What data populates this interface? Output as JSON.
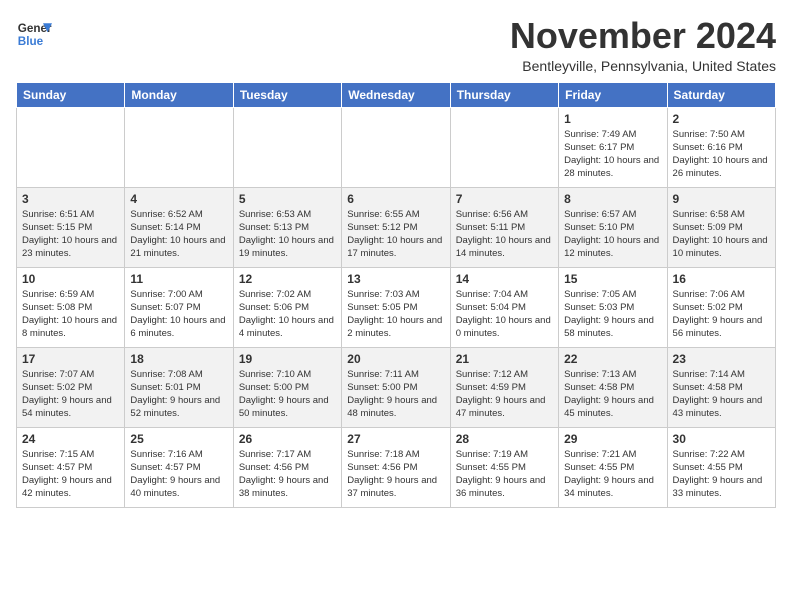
{
  "logo": {
    "line1": "General",
    "line2": "Blue"
  },
  "title": "November 2024",
  "location": "Bentleyville, Pennsylvania, United States",
  "weekdays": [
    "Sunday",
    "Monday",
    "Tuesday",
    "Wednesday",
    "Thursday",
    "Friday",
    "Saturday"
  ],
  "weeks": [
    [
      {
        "day": "",
        "info": ""
      },
      {
        "day": "",
        "info": ""
      },
      {
        "day": "",
        "info": ""
      },
      {
        "day": "",
        "info": ""
      },
      {
        "day": "",
        "info": ""
      },
      {
        "day": "1",
        "info": "Sunrise: 7:49 AM\nSunset: 6:17 PM\nDaylight: 10 hours and 28 minutes."
      },
      {
        "day": "2",
        "info": "Sunrise: 7:50 AM\nSunset: 6:16 PM\nDaylight: 10 hours and 26 minutes."
      }
    ],
    [
      {
        "day": "3",
        "info": "Sunrise: 6:51 AM\nSunset: 5:15 PM\nDaylight: 10 hours and 23 minutes."
      },
      {
        "day": "4",
        "info": "Sunrise: 6:52 AM\nSunset: 5:14 PM\nDaylight: 10 hours and 21 minutes."
      },
      {
        "day": "5",
        "info": "Sunrise: 6:53 AM\nSunset: 5:13 PM\nDaylight: 10 hours and 19 minutes."
      },
      {
        "day": "6",
        "info": "Sunrise: 6:55 AM\nSunset: 5:12 PM\nDaylight: 10 hours and 17 minutes."
      },
      {
        "day": "7",
        "info": "Sunrise: 6:56 AM\nSunset: 5:11 PM\nDaylight: 10 hours and 14 minutes."
      },
      {
        "day": "8",
        "info": "Sunrise: 6:57 AM\nSunset: 5:10 PM\nDaylight: 10 hours and 12 minutes."
      },
      {
        "day": "9",
        "info": "Sunrise: 6:58 AM\nSunset: 5:09 PM\nDaylight: 10 hours and 10 minutes."
      }
    ],
    [
      {
        "day": "10",
        "info": "Sunrise: 6:59 AM\nSunset: 5:08 PM\nDaylight: 10 hours and 8 minutes."
      },
      {
        "day": "11",
        "info": "Sunrise: 7:00 AM\nSunset: 5:07 PM\nDaylight: 10 hours and 6 minutes."
      },
      {
        "day": "12",
        "info": "Sunrise: 7:02 AM\nSunset: 5:06 PM\nDaylight: 10 hours and 4 minutes."
      },
      {
        "day": "13",
        "info": "Sunrise: 7:03 AM\nSunset: 5:05 PM\nDaylight: 10 hours and 2 minutes."
      },
      {
        "day": "14",
        "info": "Sunrise: 7:04 AM\nSunset: 5:04 PM\nDaylight: 10 hours and 0 minutes."
      },
      {
        "day": "15",
        "info": "Sunrise: 7:05 AM\nSunset: 5:03 PM\nDaylight: 9 hours and 58 minutes."
      },
      {
        "day": "16",
        "info": "Sunrise: 7:06 AM\nSunset: 5:02 PM\nDaylight: 9 hours and 56 minutes."
      }
    ],
    [
      {
        "day": "17",
        "info": "Sunrise: 7:07 AM\nSunset: 5:02 PM\nDaylight: 9 hours and 54 minutes."
      },
      {
        "day": "18",
        "info": "Sunrise: 7:08 AM\nSunset: 5:01 PM\nDaylight: 9 hours and 52 minutes."
      },
      {
        "day": "19",
        "info": "Sunrise: 7:10 AM\nSunset: 5:00 PM\nDaylight: 9 hours and 50 minutes."
      },
      {
        "day": "20",
        "info": "Sunrise: 7:11 AM\nSunset: 5:00 PM\nDaylight: 9 hours and 48 minutes."
      },
      {
        "day": "21",
        "info": "Sunrise: 7:12 AM\nSunset: 4:59 PM\nDaylight: 9 hours and 47 minutes."
      },
      {
        "day": "22",
        "info": "Sunrise: 7:13 AM\nSunset: 4:58 PM\nDaylight: 9 hours and 45 minutes."
      },
      {
        "day": "23",
        "info": "Sunrise: 7:14 AM\nSunset: 4:58 PM\nDaylight: 9 hours and 43 minutes."
      }
    ],
    [
      {
        "day": "24",
        "info": "Sunrise: 7:15 AM\nSunset: 4:57 PM\nDaylight: 9 hours and 42 minutes."
      },
      {
        "day": "25",
        "info": "Sunrise: 7:16 AM\nSunset: 4:57 PM\nDaylight: 9 hours and 40 minutes."
      },
      {
        "day": "26",
        "info": "Sunrise: 7:17 AM\nSunset: 4:56 PM\nDaylight: 9 hours and 38 minutes."
      },
      {
        "day": "27",
        "info": "Sunrise: 7:18 AM\nSunset: 4:56 PM\nDaylight: 9 hours and 37 minutes."
      },
      {
        "day": "28",
        "info": "Sunrise: 7:19 AM\nSunset: 4:55 PM\nDaylight: 9 hours and 36 minutes."
      },
      {
        "day": "29",
        "info": "Sunrise: 7:21 AM\nSunset: 4:55 PM\nDaylight: 9 hours and 34 minutes."
      },
      {
        "day": "30",
        "info": "Sunrise: 7:22 AM\nSunset: 4:55 PM\nDaylight: 9 hours and 33 minutes."
      }
    ]
  ]
}
